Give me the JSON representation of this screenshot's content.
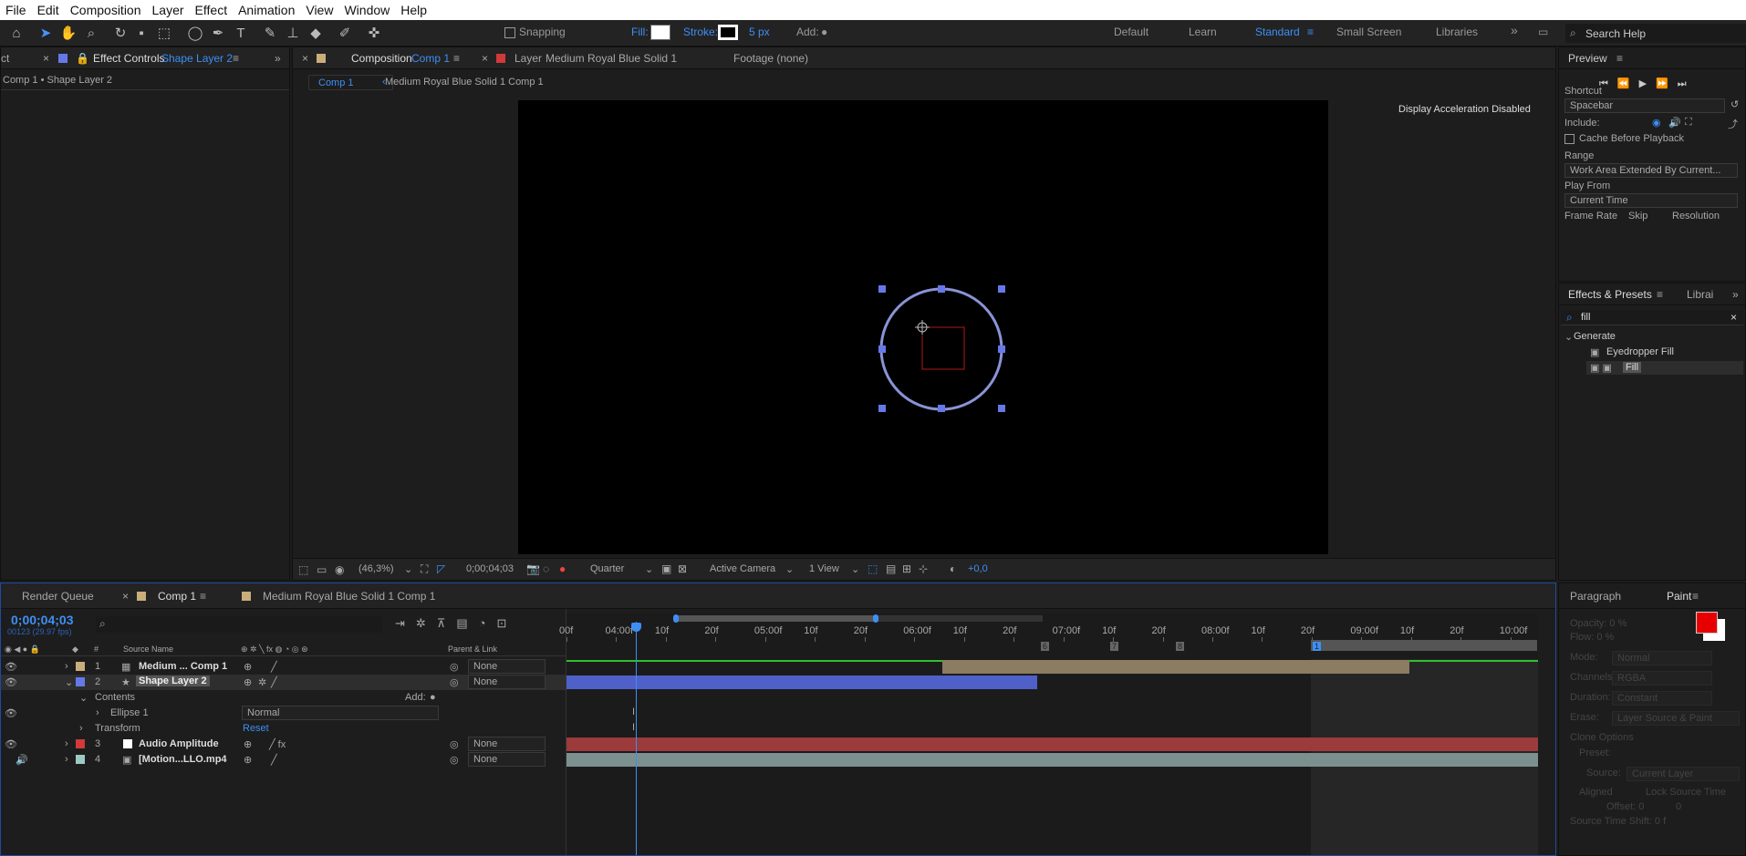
{
  "menu": [
    "File",
    "Edit",
    "Composition",
    "Layer",
    "Effect",
    "Animation",
    "View",
    "Window",
    "Help"
  ],
  "toolbar": {
    "snapping": "Snapping",
    "fill": "Fill:",
    "stroke": "Stroke:",
    "stroke_width": "5 px",
    "add": "Add:",
    "workspaces": [
      "Default",
      "Learn",
      "Standard",
      "Small Screen",
      "Libraries"
    ],
    "search_placeholder": "Search Help"
  },
  "left_panel": {
    "tab_prefix": "ct",
    "tab_label": "Effect Controls",
    "tab_layer": "Shape Layer 2",
    "breadcrumb": "Comp 1 • Shape Layer 2"
  },
  "comp_panel": {
    "tab_label": "Composition",
    "tab_comp": "Comp 1",
    "layer_tab_label": "Layer",
    "layer_tab_name": "Medium Royal Blue Solid 1",
    "footage_tab": "Footage (none)",
    "crumb1": "Comp 1",
    "crumb2": "Medium Royal Blue Solid 1 Comp 1",
    "accel_msg": "Display Acceleration Disabled",
    "zoom": "(46,3%)",
    "timecode": "0;00;04;03",
    "resolution": "Quarter",
    "camera": "Active Camera",
    "views": "1 View",
    "exposure": "+0,0"
  },
  "preview": {
    "title": "Preview",
    "shortcut_label": "Shortcut",
    "shortcut": "Spacebar",
    "include": "Include:",
    "cache": "Cache Before Playback",
    "range_label": "Range",
    "range": "Work Area Extended By Current...",
    "playfrom_label": "Play From",
    "playfrom": "Current Time",
    "fr_label": "Frame Rate",
    "skip_label": "Skip",
    "res_label": "Resolution"
  },
  "effects": {
    "title": "Effects & Presets",
    "libs": "Librai",
    "search": "fill",
    "group": "Generate",
    "items": [
      "Eyedropper Fill",
      "Fill"
    ]
  },
  "timeline": {
    "tabs": [
      "Render Queue",
      "Comp 1",
      "Medium Royal Blue Solid 1 Comp 1"
    ],
    "timecode": "0;00;04;03",
    "frames": "00123 (29.97 fps)",
    "col_source": "Source Name",
    "col_parent": "Parent & Link",
    "ruler": [
      "00f",
      "04:00f",
      "10f",
      "20f",
      "05:00f",
      "10f",
      "20f",
      "06:00f",
      "10f",
      "20f",
      "07:00f",
      "10f",
      "20f",
      "08:00f",
      "10f",
      "20f",
      "09:00f",
      "10f",
      "20f",
      "10:00f"
    ],
    "layers": [
      {
        "num": "1",
        "name": "Medium ... Comp 1",
        "color": "#c9ad7a",
        "parent": "None"
      },
      {
        "num": "2",
        "name": "Shape Layer 2",
        "color": "#6678e8",
        "parent": "None"
      },
      {
        "num": "3",
        "name": "Audio Amplitude",
        "color": "#d03a3a",
        "parent": "None"
      },
      {
        "num": "4",
        "name": "[Motion...LLO.mp4",
        "color": "#9dc9c3",
        "parent": "None"
      }
    ],
    "contents": "Contents",
    "add": "Add:",
    "ellipse": "Ellipse 1",
    "blend": "Normal",
    "transform": "Transform",
    "reset": "Reset"
  },
  "paint": {
    "tab1": "Paragraph",
    "tab2": "Paint",
    "opacity": "Opacity: 0 %",
    "flow": "Flow: 0 %",
    "mode_label": "Mode:",
    "mode": "Normal",
    "channels_label": "Channels:",
    "channels": "RGBA",
    "duration_label": "Duration:",
    "duration": "Constant",
    "erase_label": "Erase:",
    "erase": "Layer Source & Paint",
    "clone": "Clone Options",
    "preset": "Preset:",
    "source_label": "Source:",
    "source": "Current Layer",
    "aligned": "Aligned",
    "lock": "Lock Source Time",
    "offset": "Offset: 0",
    "offset2": "0",
    "shift": "Source Time Shift: 0 f",
    "fg_color": "#e80000"
  }
}
